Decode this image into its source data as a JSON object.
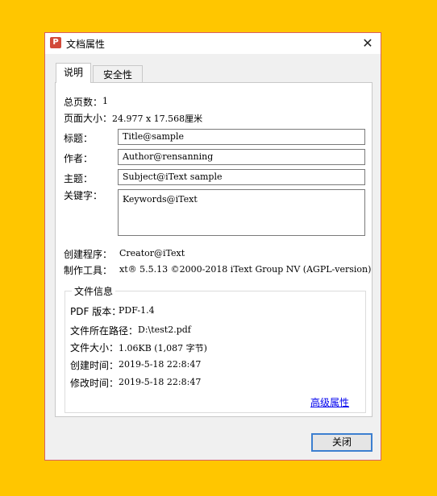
{
  "window": {
    "title": "文档属性",
    "app_icon": "pdf-app-icon",
    "close_icon": "close-icon",
    "close_glyph": "✕",
    "icon_glyph": "P"
  },
  "tabs": [
    {
      "label": "说明",
      "active": true
    },
    {
      "label": "安全性",
      "active": false
    }
  ],
  "description": {
    "page_count_label": "总页数：",
    "page_count_value": "1",
    "page_size_label": "页面大小：",
    "page_size_value": "24.977 x 17.568厘米",
    "title_label": "标题：",
    "title_value": "Title@sample",
    "author_label": "作者：",
    "author_value": "Author@rensanning",
    "subject_label": "主题：",
    "subject_value": "Subject@iText sample",
    "keywords_label": "关键字：",
    "keywords_value": "Keywords@iText",
    "creator_label": "创建程序：",
    "creator_value": "Creator@iText",
    "producer_label": "制作工具：",
    "producer_value": "xt® 5.5.13 ©2000-2018 iText Group NV (AGPL-version)"
  },
  "file_info": {
    "group_title": "文件信息",
    "pdf_version_label": "PDF 版本：",
    "pdf_version_value": "PDF-1.4",
    "path_label": "文件所在路径：",
    "path_value": "D:\\test2.pdf",
    "size_label": "文件大小：",
    "size_value": "1.06KB (1,087 字节)",
    "created_label": "创建时间：",
    "created_value": "2019-5-18 22:8:47",
    "modified_label": "修改时间：",
    "modified_value": "2019-5-18 22:8:47",
    "advanced_link": "高级属性"
  },
  "buttons": {
    "close_label": "关闭"
  },
  "colors": {
    "background": "#FFC600",
    "window_border": "#D96060",
    "link": "#0000EE",
    "button_focus": "#3C7FD0"
  }
}
